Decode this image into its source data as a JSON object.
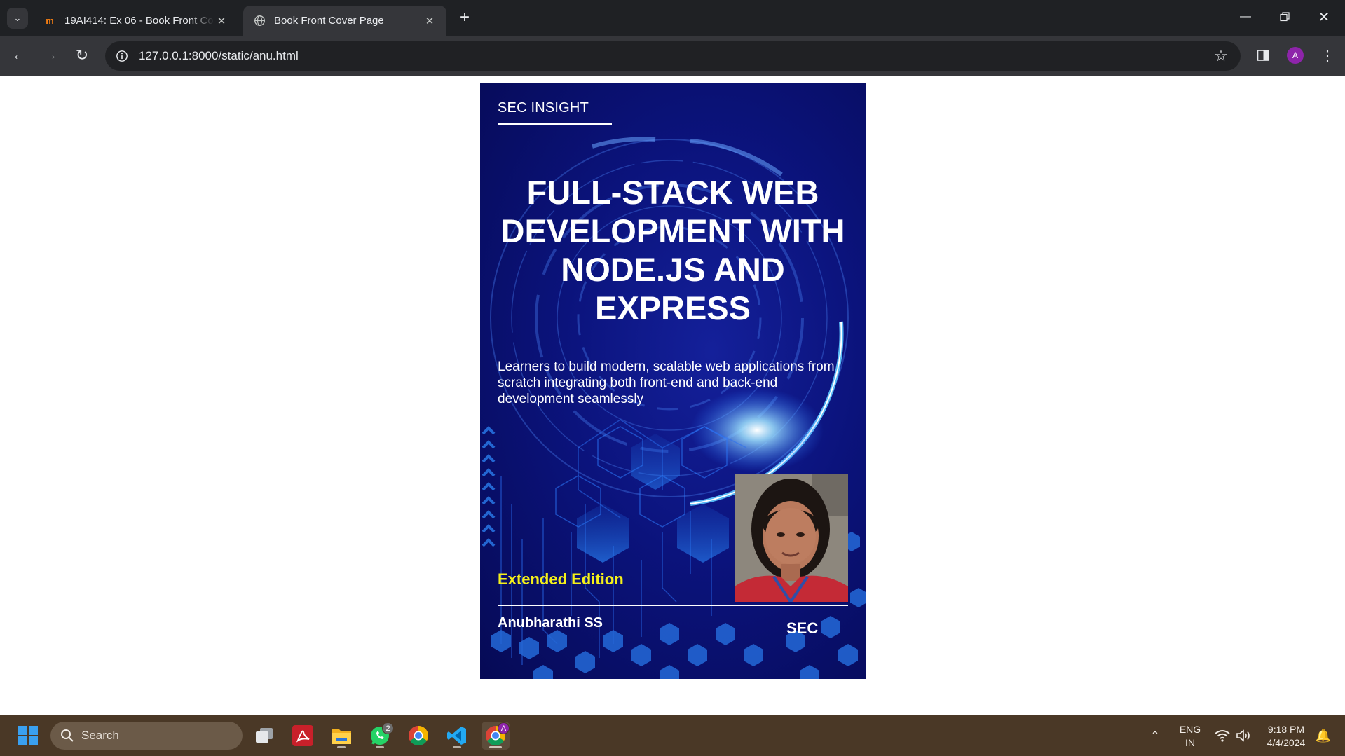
{
  "browser": {
    "tabs": [
      {
        "title": "19AI414: Ex 06 - Book Front Co",
        "favicon": "moodle-icon",
        "active": false
      },
      {
        "title": "Book Front Cover Page",
        "favicon": "globe-icon",
        "active": true
      }
    ],
    "url": "127.0.0.1:8000/static/anu.html",
    "profile_initial": "A"
  },
  "cover": {
    "publisher": "SEC INSIGHT",
    "title": "FULL-STACK WEB DEVELOPMENT WITH NODE.JS AND EXPRESS",
    "description": "Learners to build modern, scalable web applications from scratch integrating both front-end and back-end development seamlessly",
    "edition": "Extended Edition",
    "author": "Anubharathi SS",
    "imprint": "SEC",
    "colors": {
      "background": "#0b137c",
      "edition": "#f5f01a",
      "accent": "#5ec8ff"
    }
  },
  "taskbar": {
    "search_label": "Search",
    "whatsapp_badge": "2",
    "chrome_profile_badge": "A",
    "language_line1": "ENG",
    "language_line2": "IN",
    "time": "9:18 PM",
    "date": "4/4/2024"
  }
}
